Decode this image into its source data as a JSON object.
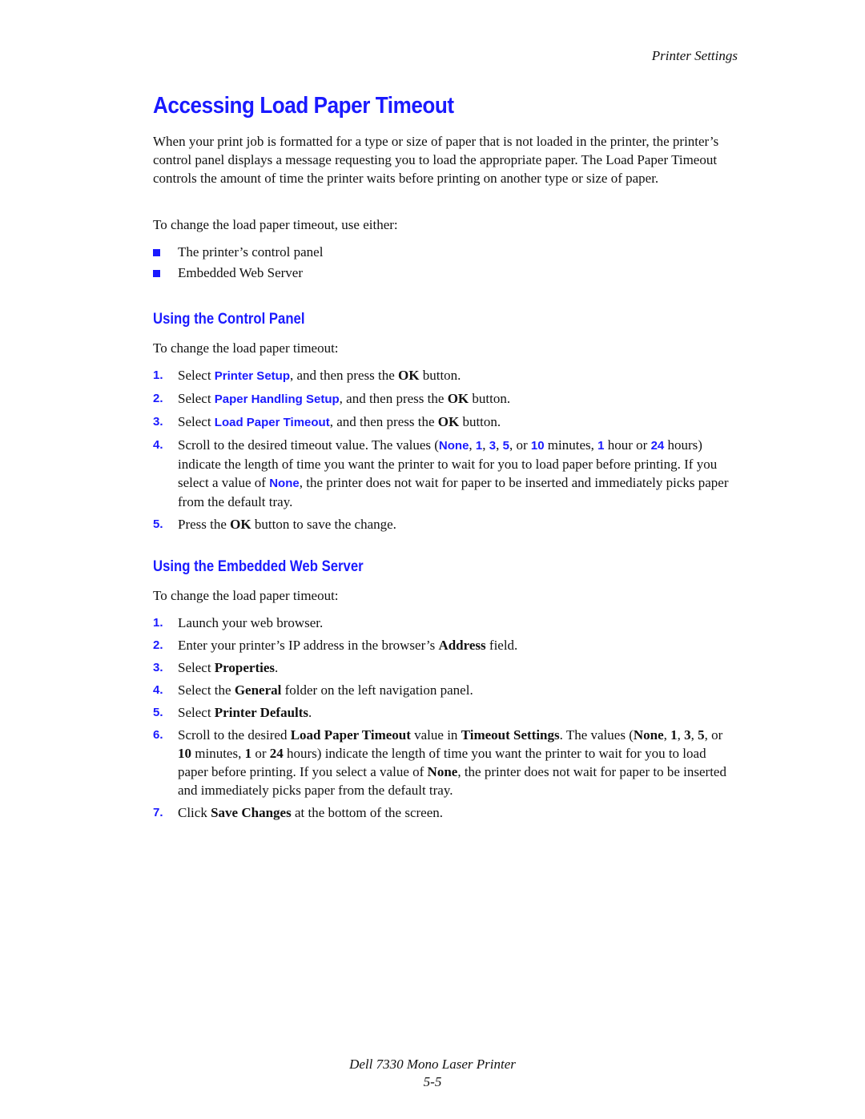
{
  "header": {
    "running_head": "Printer Settings"
  },
  "title": "Accessing Load Paper Timeout",
  "intro": "When your print job is formatted for a type or size of paper that is not loaded in the printer, the printer’s control panel displays a message requesting you to load the appropriate paper. The Load Paper Timeout controls the amount of time the printer waits before printing on another type or size of paper.",
  "methods_intro": "To change the load paper timeout, use either:",
  "methods": [
    "The printer’s control panel",
    "Embedded Web Server"
  ],
  "control_panel": {
    "heading": "Using the Control Panel",
    "intro": "To change the load paper timeout:",
    "steps": [
      {
        "num": "1.",
        "pre": "Select ",
        "hl": "Printer Setup",
        "mid": ", and then press the ",
        "bold": "OK",
        "post": " button."
      },
      {
        "num": "2.",
        "pre": "Select ",
        "hl": "Paper Handling Setup",
        "mid": ", and then press the ",
        "bold": "OK",
        "post": " button."
      },
      {
        "num": "3.",
        "pre": "Select ",
        "hl": "Load Paper Timeout",
        "mid": ", and then press the ",
        "bold": "OK",
        "post": " button."
      },
      {
        "num": "4.",
        "a": "Scroll to the desired timeout value. The values (",
        "v1": "None",
        "s1": ", ",
        "v2": "1",
        "s2": ", ",
        "v3": "3",
        "s3": ", ",
        "v4": "5",
        "s4": ", or ",
        "v5": "10",
        "s5": " minutes, ",
        "v6": "1",
        "s6": " hour or ",
        "v7": "24",
        "s7": " hours) indicate the length of time you want the printer to wait for you to load paper before printing. If you select a value of ",
        "v8": "None",
        "s8": ", the printer does not wait for paper to be inserted and immediately picks paper from the default tray."
      },
      {
        "num": "5.",
        "pre": "Press the ",
        "bold": "OK",
        "post": " button to save the change."
      }
    ]
  },
  "web_server": {
    "heading": "Using the Embedded Web Server",
    "intro": "To change the load paper timeout:",
    "steps": [
      {
        "num": "1.",
        "text": "Launch your web browser."
      },
      {
        "num": "2.",
        "pre": "Enter your printer’s IP address in the browser’s ",
        "bold": "Address",
        "post": " field."
      },
      {
        "num": "3.",
        "pre": "Select ",
        "bold": "Properties",
        "post": "."
      },
      {
        "num": "4.",
        "pre": "Select the ",
        "bold": "General",
        "post": " folder on the left navigation panel."
      },
      {
        "num": "5.",
        "pre": "Select ",
        "bold": "Printer Defaults",
        "post": "."
      },
      {
        "num": "6.",
        "a": "Scroll to the desired ",
        "b1": "Load Paper Timeout",
        "s1": " value in ",
        "b2": "Timeout Settings",
        "s2": ". The values (",
        "b3": "None",
        "s3": ", ",
        "b4": "1",
        "s4": ", ",
        "b5": "3",
        "s5": ", ",
        "b6": "5",
        "s6": ", or ",
        "b7": "10",
        "s7": " minutes, ",
        "b8": "1",
        "s8": " or ",
        "b9": "24",
        "s9": " hours) indicate the length of time you want the printer to wait for you to load paper before printing. If you select a value of ",
        "b10": "None",
        "s10": ", the printer does not wait for paper to be inserted and immediately picks paper from the default tray."
      },
      {
        "num": "7.",
        "pre": "Click ",
        "bold": "Save Changes",
        "post": " at the bottom of the screen."
      }
    ]
  },
  "footer": {
    "product": "Dell 7330 Mono Laser Printer",
    "page": "5-5"
  }
}
